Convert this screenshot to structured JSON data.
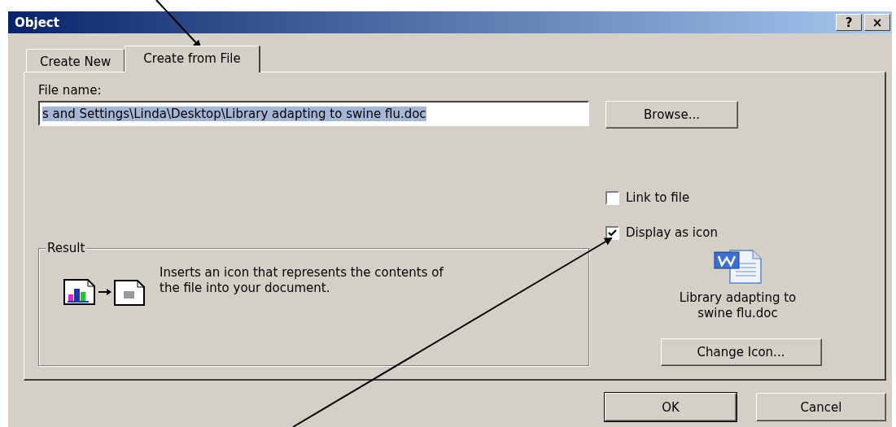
{
  "window": {
    "title": "Object",
    "title_buttons": [
      "?",
      "×"
    ]
  },
  "tabs": [
    {
      "label": "Create New",
      "selected": false
    },
    {
      "label": "Create from File",
      "selected": true
    }
  ],
  "file_name": {
    "label": "File name:",
    "value": "s and Settings\\Linda\\Desktop\\Library adapting to swine flu.doc",
    "text_selected": true
  },
  "browse_button": "Browse...",
  "options": [
    {
      "label": "Link to file",
      "checked": false
    },
    {
      "label": "Display as icon",
      "checked": true
    }
  ],
  "result": {
    "title": "Result",
    "description": "Inserts an icon that represents the contents of the file into your document."
  },
  "icon_preview": {
    "caption": "Library adapting to swine flu.doc"
  },
  "change_icon_button": "Change Icon...",
  "buttons": [
    {
      "label": "OK",
      "default": true
    },
    {
      "label": "Cancel",
      "default": false
    }
  ]
}
